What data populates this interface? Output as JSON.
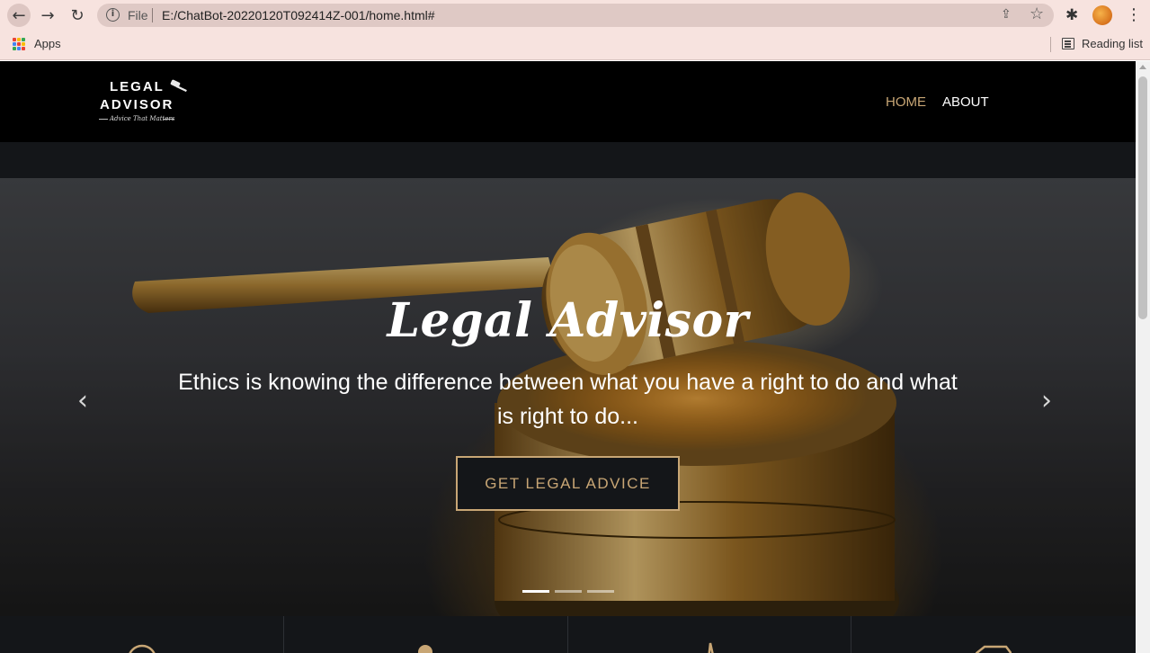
{
  "browser": {
    "file_label": "File",
    "url": "E:/ChatBot-20220120T092414Z-001/home.html#",
    "bookmarks": {
      "apps_label": "Apps",
      "reading_list_label": "Reading list"
    },
    "apps_icon_colors": [
      "#ea4335",
      "#fbbc05",
      "#34a853",
      "#4285f4",
      "#ea4335",
      "#fbbc05",
      "#34a853",
      "#4285f4",
      "#ea4335"
    ]
  },
  "site": {
    "logo": {
      "line1": "LEGAL",
      "line2": "ADVISOR",
      "tagline": "Advice That Matters"
    },
    "nav": [
      {
        "label": "HOME",
        "active": true
      },
      {
        "label": "ABOUT",
        "active": false
      }
    ],
    "hero": {
      "title": "Legal Advisor",
      "text": "Ethics is knowing the difference between what you have a right to do and what is right to do...",
      "button_label": "GET LEGAL ADVICE",
      "slides": 3,
      "active_slide": 0
    },
    "colors": {
      "accent": "#c8a675",
      "header_bg": "#000000",
      "dark_bg": "#141619"
    }
  }
}
